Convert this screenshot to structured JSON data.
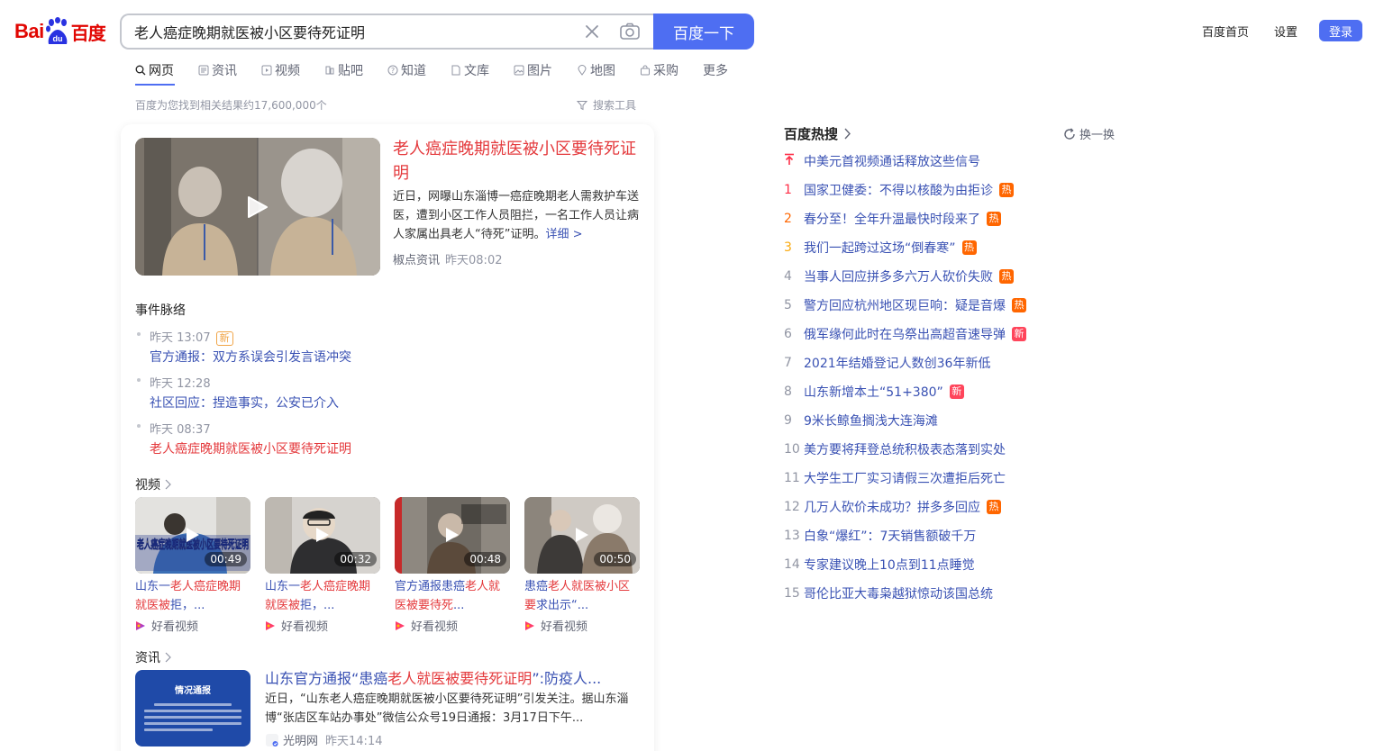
{
  "logo": {
    "part1": "Bai",
    "part2": "百度"
  },
  "search": {
    "query": "老人癌症晚期就医被小区要待死证明",
    "button": "百度一下"
  },
  "top_links": {
    "home": "百度首页",
    "settings": "设置",
    "login": "登录"
  },
  "tabs": [
    "网页",
    "资讯",
    "视频",
    "贴吧",
    "知道",
    "文库",
    "图片",
    "地图",
    "采购",
    "更多"
  ],
  "result_count": "百度为您找到相关结果约17,600,000个",
  "search_tools": "搜索工具",
  "top_result": {
    "title": "老人癌症晚期就医被小区要待死证明",
    "desc": "近日，网曝山东淄博一癌症晚期老人需救护车送医，遭到小区工作人员阻拦，一名工作人员让病人家属出具老人“待死”证明。",
    "more": "详细 >",
    "source": "椒点资讯",
    "time": "昨天08:02"
  },
  "events": {
    "title": "事件脉络",
    "new_badge": "新",
    "items": [
      {
        "time": "昨天 13:07",
        "text": "官方通报：双方系误会引发言语冲突"
      },
      {
        "time": "昨天 12:28",
        "text": "社区回应：捏造事实，公安已介入"
      },
      {
        "time": "昨天 08:37",
        "text": "老人癌症晚期就医被小区要待死证明"
      }
    ]
  },
  "videos_label": "视频",
  "videos": [
    {
      "duration": "00:49",
      "t1": "山东一",
      "t2": "老人癌症晚期就医被",
      "t3": "拒，...",
      "source": "好看视频"
    },
    {
      "duration": "00:32",
      "t1": "山东一",
      "t2": "老人癌症晚期就医被",
      "t3": "拒，...",
      "source": "好看视频"
    },
    {
      "duration": "00:48",
      "t1": "官方通报患癌",
      "t2": "老人就医被要待死",
      "t3": "...",
      "source": "好看视频"
    },
    {
      "duration": "00:50",
      "t1": "患癌",
      "t2": "老人就医被小区要",
      "t3": "求出示“...",
      "source": "好看视频"
    }
  ],
  "video0_overlay": "老人癌症晚期就医被小区要待死证明",
  "news_label": "资讯",
  "news": {
    "thumb_title": "情况通报",
    "title_a": "山东官方通报“患癌",
    "title_b": "老人就医被要待死证明",
    "title_c": "”:防疫人...",
    "desc": "近日，“山东老人癌症晚期就医被小区要待死证明”引发关注。据山东淄博“张店区车站办事处”微信公众号19日通报：3月17日下午...",
    "source": "光明网",
    "time": "昨天14:14"
  },
  "hot": {
    "title": "百度热搜",
    "refresh": "换一换",
    "badge_hot": "热",
    "badge_new": "新",
    "items": [
      {
        "rank": "",
        "text": "中美元首视频通话释放这些信号",
        "badge": ""
      },
      {
        "rank": "1",
        "text": "国家卫健委：不得以核酸为由拒诊",
        "badge": "hot"
      },
      {
        "rank": "2",
        "text": "春分至！全年升温最快时段来了",
        "badge": "hot"
      },
      {
        "rank": "3",
        "text": "我们一起跨过这场“倒春寒”",
        "badge": "hot"
      },
      {
        "rank": "4",
        "text": "当事人回应拼多多六万人砍价失败",
        "badge": "hot"
      },
      {
        "rank": "5",
        "text": "警方回应杭州地区现巨响：疑是音爆",
        "badge": "hot"
      },
      {
        "rank": "6",
        "text": "俄军缘何此时在乌祭出高超音速导弹",
        "badge": "new"
      },
      {
        "rank": "7",
        "text": "2021年结婚登记人数创36年新低",
        "badge": ""
      },
      {
        "rank": "8",
        "text": "山东新增本土“51+380”",
        "badge": "new"
      },
      {
        "rank": "9",
        "text": "9米长鲸鱼搁浅大连海滩",
        "badge": ""
      },
      {
        "rank": "10",
        "text": "美方要将拜登总统积极表态落到实处",
        "badge": ""
      },
      {
        "rank": "11",
        "text": "大学生工厂实习请假三次遭拒后死亡",
        "badge": ""
      },
      {
        "rank": "12",
        "text": "几万人砍价未成功？拼多多回应",
        "badge": "hot"
      },
      {
        "rank": "13",
        "text": "白象“爆红”：7天销售额破千万",
        "badge": ""
      },
      {
        "rank": "14",
        "text": "专家建议晚上10点到11点睡觉",
        "badge": ""
      },
      {
        "rank": "15",
        "text": "哥伦比亚大毒枭越狱惊动该国总统",
        "badge": ""
      }
    ]
  },
  "colors": {
    "accent": "#4e6ef2",
    "link": "#3951b3",
    "red": "#e4393c",
    "hot": "#ff6600",
    "new": "#ff455b"
  }
}
